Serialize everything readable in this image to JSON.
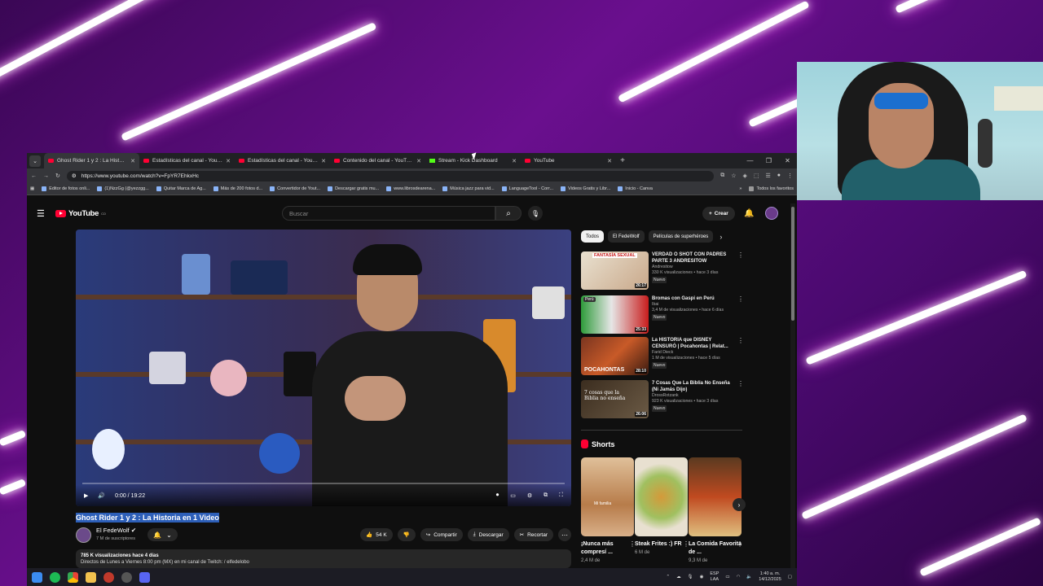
{
  "browser": {
    "tabs": [
      {
        "title": "Ghost Rider 1 y 2 : La Historia e",
        "favicon": "youtube-icon",
        "active": true
      },
      {
        "title": "Estadísticas del canal - YouTube",
        "favicon": "youtube-icon",
        "active": false
      },
      {
        "title": "Estadísticas del canal - YouTube",
        "favicon": "youtube-icon",
        "active": false
      },
      {
        "title": "Contenido del canal - YouTube",
        "favicon": "youtube-icon",
        "active": false
      },
      {
        "title": "Stream - Kick Dashboard",
        "favicon": "kick-icon",
        "active": false
      },
      {
        "title": "YouTube",
        "favicon": "youtube-icon",
        "active": false
      }
    ],
    "new_tab": "+",
    "url": "https://www.youtube.com/watch?v=FpYR7EhkxHc",
    "bookmarks": [
      "Editor de fotos onli...",
      "(1)NzzGg (@yezzgg...",
      "Quitar Marca de Ag...",
      "Más de 200 fotos d...",
      "Convertidor de Yout...",
      "Descargar gratis mu...",
      "www.librosdearena...",
      "Música jazz para vid...",
      "LanguageTool - Corr...",
      "Videos Gratis y Libr...",
      "Inicio - Canva"
    ],
    "bookmarks_more": "»",
    "all_bookmarks": "Todos los favoritos"
  },
  "youtube": {
    "logo_text": "YouTube",
    "logo_country": "CO",
    "search_placeholder": "Buscar",
    "create_label": "Crear",
    "video": {
      "time": "0:00 / 19:22",
      "title": "Ghost Rider 1 y 2 : La Historia en 1 Video",
      "channel": "El FedeWolf",
      "subscribers": "7 M de suscriptores",
      "likes": "54 K",
      "share": "Compartir",
      "download": "Descargar",
      "clip": "Recortar",
      "views_date": "785 K visualizaciones  hace 4 días",
      "description": "Directos de Lunes a Viernes 8:00 pm (MX) en mi canal de Twitch:  / elfedelobo"
    },
    "chips": [
      "Todos",
      "El FedeWolf",
      "Películas de superhéroes"
    ],
    "recommendations": [
      {
        "title": "VERDAD O SHOT CON PADRES PARTE 3 ANDRESITOW",
        "channel": "Andresitow",
        "meta": "330 K visualizaciones • hace 3 días",
        "badge": "Nuevo",
        "duration": "26:17",
        "thumb_caption": "FANTASÍA SEXUAL"
      },
      {
        "title": "Bromas con Gaspi en Perú",
        "channel": "Ibai",
        "meta": "3,4 M de visualizaciones • hace 6 días",
        "badge": "Nuevo",
        "duration": "25:33",
        "thumb_caption": "Perú"
      },
      {
        "title": "La HISTORIA que DISNEY CENSURÓ | Pocahontas | Relat...",
        "channel": "Farid Dieck",
        "meta": "1 M de visualizaciones • hace 5 días",
        "badge": "Nuevo",
        "duration": "28:10",
        "thumb_caption": "POCAHONTAS"
      },
      {
        "title": "7 Cosas Que La Biblia No Enseña (Ni Jamás Dijo)",
        "channel": "DrossRotzank",
        "meta": "923 K visualizaciones • hace 3 días",
        "badge": "Nuevo",
        "duration": "26:06",
        "thumb_caption": "7 cosas que la Biblia no enseña"
      }
    ],
    "shorts_label": "Shorts",
    "shorts": [
      {
        "title": "¡Nunca más compresí ...",
        "meta": "2,4 M de",
        "overlay": "Mi familia"
      },
      {
        "title": "Steak Frites :) FR",
        "meta": "6 M de",
        "overlay": ""
      },
      {
        "title": "La Comida Favorita de ...",
        "meta": "9,3 M de",
        "overlay": ""
      }
    ]
  },
  "taskbar": {
    "lang_line1": "ESP",
    "lang_line2": "LAA",
    "time": "1:40 a. m.",
    "date": "14/12/2025"
  },
  "colors": {
    "youtube_red": "#ff0033",
    "background_purple": "#6a0f8e",
    "dark": "#0f0f0f"
  }
}
